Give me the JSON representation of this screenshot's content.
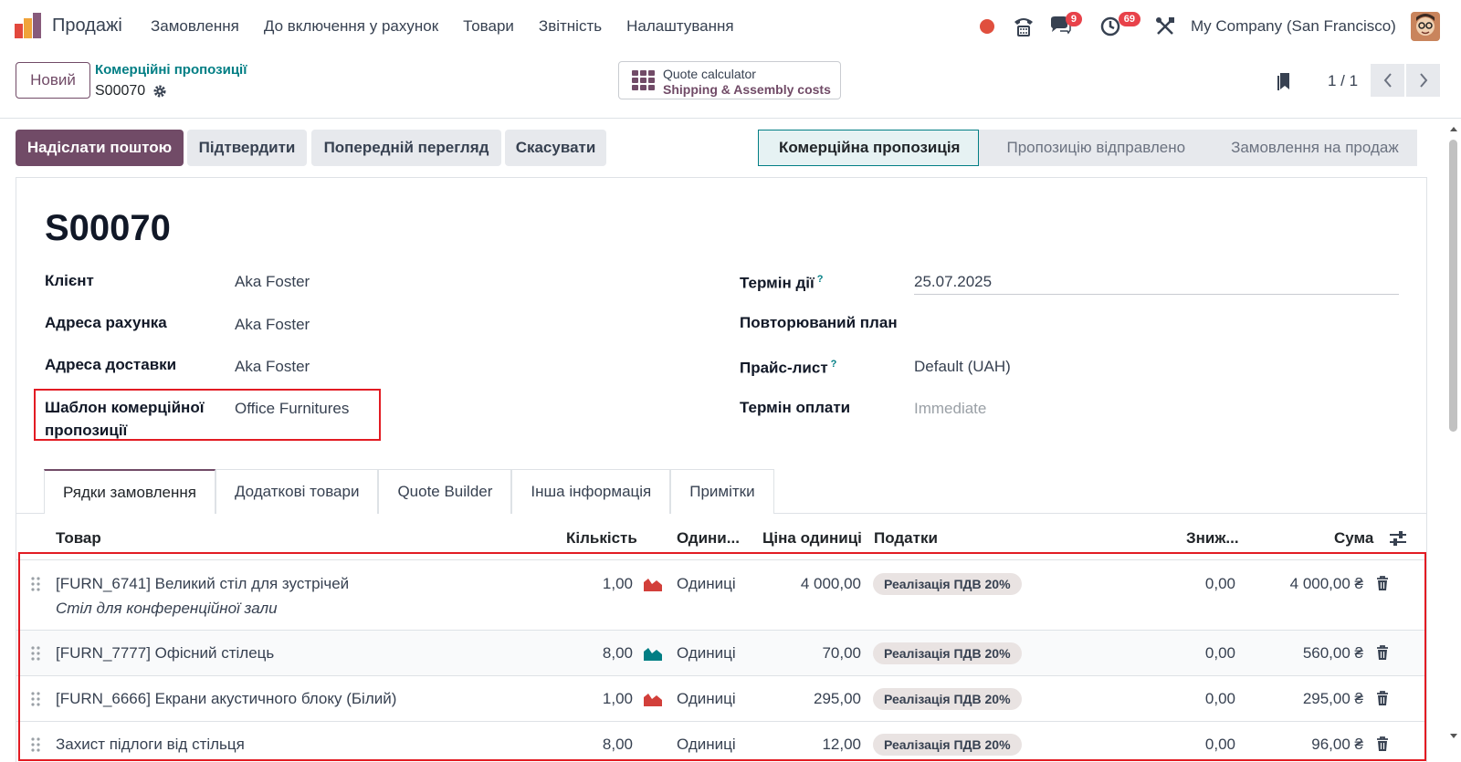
{
  "navbar": {
    "app_name": "Продажі",
    "menu": [
      "Замовлення",
      "До включення у рахунок",
      "Товари",
      "Звітність",
      "Налаштування"
    ],
    "messages_badge": "9",
    "activities_badge": "69",
    "company": "My Company (San Francisco)"
  },
  "control_panel": {
    "new_button": "Новий",
    "breadcrumb_parent": "Комерційні пропозиції",
    "breadcrumb_current": "S00070",
    "quote_calc_line1": "Quote calculator",
    "quote_calc_line2": "Shipping & Assembly costs",
    "pager": "1 / 1"
  },
  "actions": {
    "send_email": "Надіслати поштою",
    "confirm": "Підтвердити",
    "preview": "Попередній перегляд",
    "cancel": "Скасувати"
  },
  "status_stages": [
    "Комерційна пропозиція",
    "Пропозицію відправлено",
    "Замовлення на продаж"
  ],
  "form": {
    "title": "S00070",
    "left": [
      {
        "label": "Клієнт",
        "value": "Aka Foster"
      },
      {
        "label": "Адреса рахунка",
        "value": "Aka Foster"
      },
      {
        "label": "Адреса доставки",
        "value": "Aka Foster"
      },
      {
        "label": "Шаблон комерційної пропозиції",
        "value": "Office Furnitures"
      }
    ],
    "right": [
      {
        "label": "Термін дії",
        "help": "?",
        "value": "25.07.2025"
      },
      {
        "label": "Повторюваний план",
        "value": ""
      },
      {
        "label": "Прайс-лист",
        "help": "?",
        "value": "Default (UAH)"
      },
      {
        "label": "Термін оплати",
        "value": "Immediate"
      }
    ]
  },
  "tabs": [
    "Рядки замовлення",
    "Додаткові товари",
    "Quote Builder",
    "Інша інформація",
    "Примітки"
  ],
  "table": {
    "headers": {
      "product": "Товар",
      "qty": "Кількість",
      "uom": "Одини...",
      "price": "Ціна одиниці",
      "taxes": "Податки",
      "discount": "Зниж...",
      "total": "Сума"
    },
    "rows": [
      {
        "product": "[FURN_6741] Великий стіл для зустрічей",
        "description": "Стіл для конференційної зали",
        "qty": "1,00",
        "forecast": "red",
        "uom": "Одиниці",
        "price": "4 000,00",
        "tax": "Реалізація ПДВ 20%",
        "discount": "0,00",
        "total": "4 000,00 ₴"
      },
      {
        "product": "[FURN_7777] Офісний стілець",
        "description": "",
        "qty": "8,00",
        "forecast": "teal",
        "uom": "Одиниці",
        "price": "70,00",
        "tax": "Реалізація ПДВ 20%",
        "discount": "0,00",
        "total": "560,00 ₴"
      },
      {
        "product": "[FURN_6666] Екрани акустичного блоку (Білий)",
        "description": "",
        "qty": "1,00",
        "forecast": "red",
        "uom": "Одиниці",
        "price": "295,00",
        "tax": "Реалізація ПДВ 20%",
        "discount": "0,00",
        "total": "295,00 ₴"
      },
      {
        "product": "Захист підлоги від стільця",
        "description": "",
        "qty": "8,00",
        "forecast": "",
        "uom": "Одиниці",
        "price": "12,00",
        "tax": "Реалізація ПДВ 20%",
        "discount": "0,00",
        "total": "96,00 ₴"
      }
    ]
  },
  "colors": {
    "brand": "#714b67",
    "accent": "#017e84",
    "highlight": "#e21b23"
  }
}
